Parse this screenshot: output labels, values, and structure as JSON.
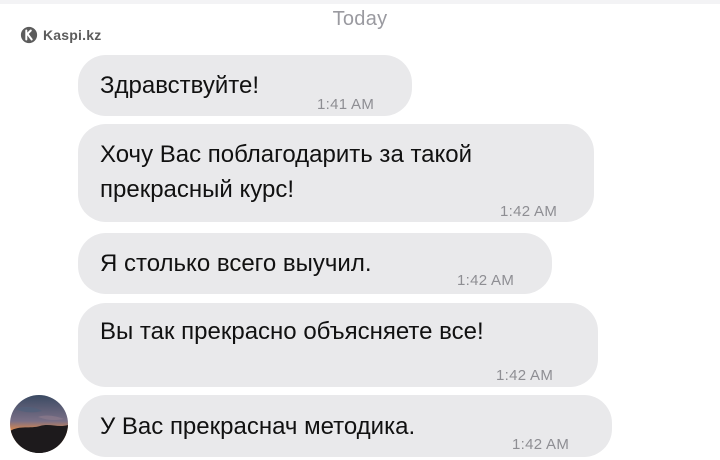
{
  "watermark": {
    "brand": "Kaspi.kz",
    "icon": "kaspi-logo-icon"
  },
  "chat": {
    "date_separator": "Today",
    "messages": [
      {
        "lines": [
          "Здравствуйте!"
        ],
        "time": "1:41 AM"
      },
      {
        "lines": [
          "Хочу Вас поблагодарить за такой",
          "прекрасный курс!"
        ],
        "time": "1:42 AM"
      },
      {
        "lines": [
          "Я столько всего выучил."
        ],
        "time": "1:42 AM"
      },
      {
        "lines": [
          "Вы так прекрасно объясняете все!"
        ],
        "time": "1:42 AM"
      },
      {
        "lines": [
          "У Вас прекраснач методика."
        ],
        "time": "1:42 AM"
      }
    ],
    "sender_avatar": "sunset-avatar-icon"
  },
  "colors": {
    "bubble": "#e9e9eb",
    "text": "#111111",
    "timestamp": "#8e8e93",
    "date_separator": "#9a9aa0"
  }
}
